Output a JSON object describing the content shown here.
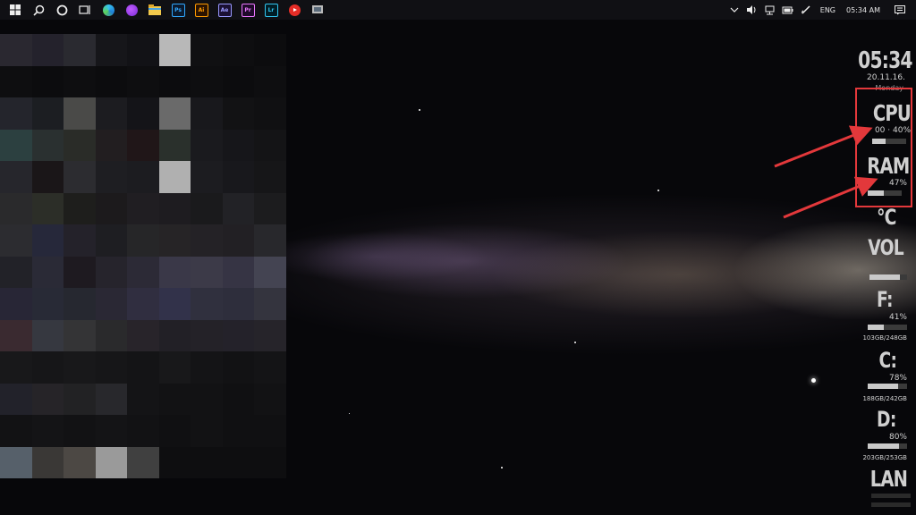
{
  "taskbar": {
    "apps": [
      {
        "name": "start-icon",
        "label": ""
      },
      {
        "name": "search-icon",
        "label": ""
      },
      {
        "name": "cortana-icon",
        "label": ""
      },
      {
        "name": "task-view-icon",
        "label": ""
      },
      {
        "name": "edge-icon",
        "label": ""
      },
      {
        "name": "firefox-icon",
        "label": ""
      },
      {
        "name": "file-explorer-icon",
        "label": ""
      },
      {
        "name": "photoshop-icon",
        "label": "Ps"
      },
      {
        "name": "illustrator-icon",
        "label": "Ai"
      },
      {
        "name": "after-effects-icon",
        "label": "Ae"
      },
      {
        "name": "premiere-icon",
        "label": "Pr"
      },
      {
        "name": "lightroom-icon",
        "label": "Lr"
      },
      {
        "name": "youtube-icon",
        "label": ""
      },
      {
        "name": "app-icon",
        "label": ""
      }
    ],
    "tray": {
      "language": "ENG",
      "time": "05:34 AM"
    }
  },
  "widgets": {
    "clock": {
      "time": "05:34",
      "date": "20.11.16.",
      "day": "Monday"
    },
    "cpu": {
      "label": "CPU",
      "readout": "00 · 40%",
      "level": 0.4
    },
    "ram": {
      "label": "RAM",
      "readout": "47%",
      "level": 0.47
    },
    "temp": {
      "label": "°C"
    },
    "vol": {
      "label": "VOL",
      "level": 0.8
    },
    "drive_f": {
      "label": "F:",
      "percent": "41%",
      "usage": "103GB/248GB",
      "level": 0.41
    },
    "drive_c": {
      "label": "C:",
      "percent": "78%",
      "usage": "188GB/242GB",
      "level": 0.78
    },
    "drive_d": {
      "label": "D:",
      "percent": "80%",
      "usage": "203GB/253GB",
      "level": 0.8
    },
    "lan": {
      "label": "LAN"
    }
  },
  "colors": {
    "annotation": "#e3383b",
    "taskbar": "#101014"
  }
}
